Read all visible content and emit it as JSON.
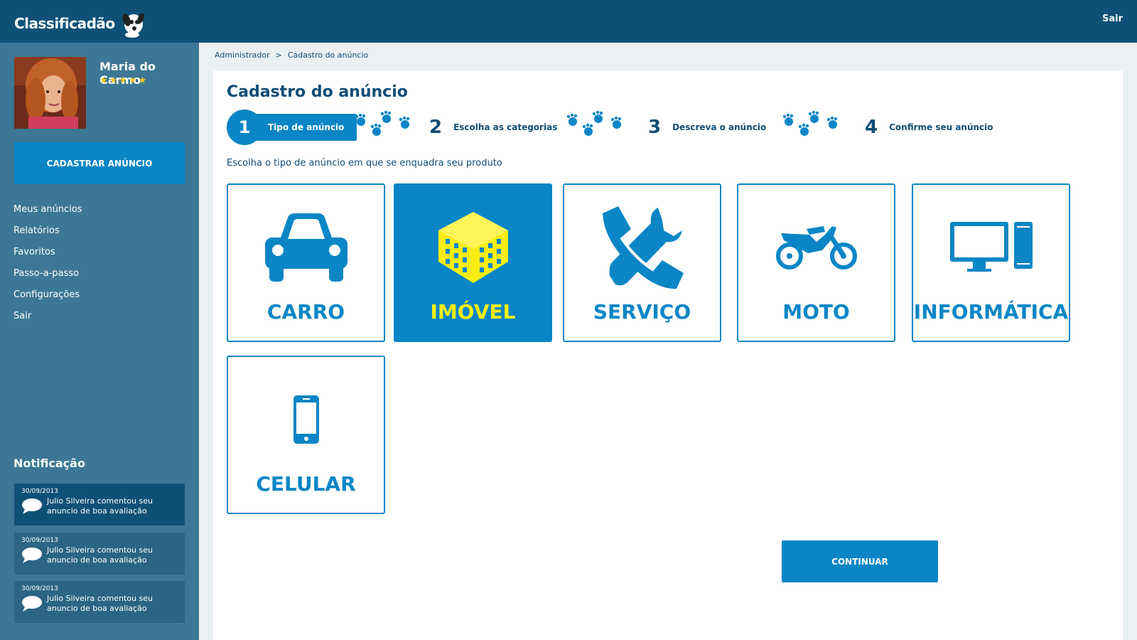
{
  "header": {
    "logo_text": "Classificadão",
    "logout_label": "Sair"
  },
  "user": {
    "name": "Maria do Carmo",
    "rating_stars": "★★★★★"
  },
  "sidebar": {
    "cta_label": "CADASTRAR ANÚNCIO",
    "menu": [
      {
        "label": "Meus anúncios"
      },
      {
        "label": "Relatórios"
      },
      {
        "label": "Favoritos"
      },
      {
        "label": "Passo-a-passo"
      },
      {
        "label": "Configurações"
      },
      {
        "label": "Sair"
      }
    ],
    "notifications_title": "Notificação",
    "notifications": [
      {
        "date": "30/09/2013",
        "text": "Julio Silveira comentou seu anuncio de boa avaliação"
      },
      {
        "date": "30/09/2013",
        "text": "Julio Silveira comentou seu anuncio de boa avaliação"
      },
      {
        "date": "30/09/2013",
        "text": "Julio Silveira comentou seu anuncio de boa avaliação"
      }
    ]
  },
  "breadcrumb": {
    "items": [
      "Administrador",
      "Cadastro do anúncio"
    ],
    "separator": ">"
  },
  "page": {
    "title": "Cadastro do anúncio",
    "instruction": "Escolha o tipo de anúncio em que se enquadra seu produto",
    "continue_label": "CONTINUAR"
  },
  "steps": [
    {
      "number": "1",
      "label": "Tipo de anúncio",
      "active": true
    },
    {
      "number": "2",
      "label": "Escolha as categorias",
      "active": false
    },
    {
      "number": "3",
      "label": "Descreva o anúncio",
      "active": false
    },
    {
      "number": "4",
      "label": "Confirme seu anúncio",
      "active": false
    }
  ],
  "ad_types": [
    {
      "label": "CARRO",
      "icon": "car-icon",
      "selected": false
    },
    {
      "label": "IMÓVEL",
      "icon": "building-icon",
      "selected": true
    },
    {
      "label": "SERVIÇO",
      "icon": "phone-wrench-icon",
      "selected": false
    },
    {
      "label": "MOTO",
      "icon": "motorcycle-icon",
      "selected": false
    },
    {
      "label": "INFORMÁTICA",
      "icon": "computer-icon",
      "selected": false
    },
    {
      "label": "CELULAR",
      "icon": "smartphone-icon",
      "selected": false
    }
  ],
  "colors": {
    "header_bg": "#0f5176",
    "sidebar_bg": "#3c7795",
    "accent_blue": "#0a86c6",
    "selected_label": "#f8ee14",
    "star_yellow": "#f7c81b"
  }
}
